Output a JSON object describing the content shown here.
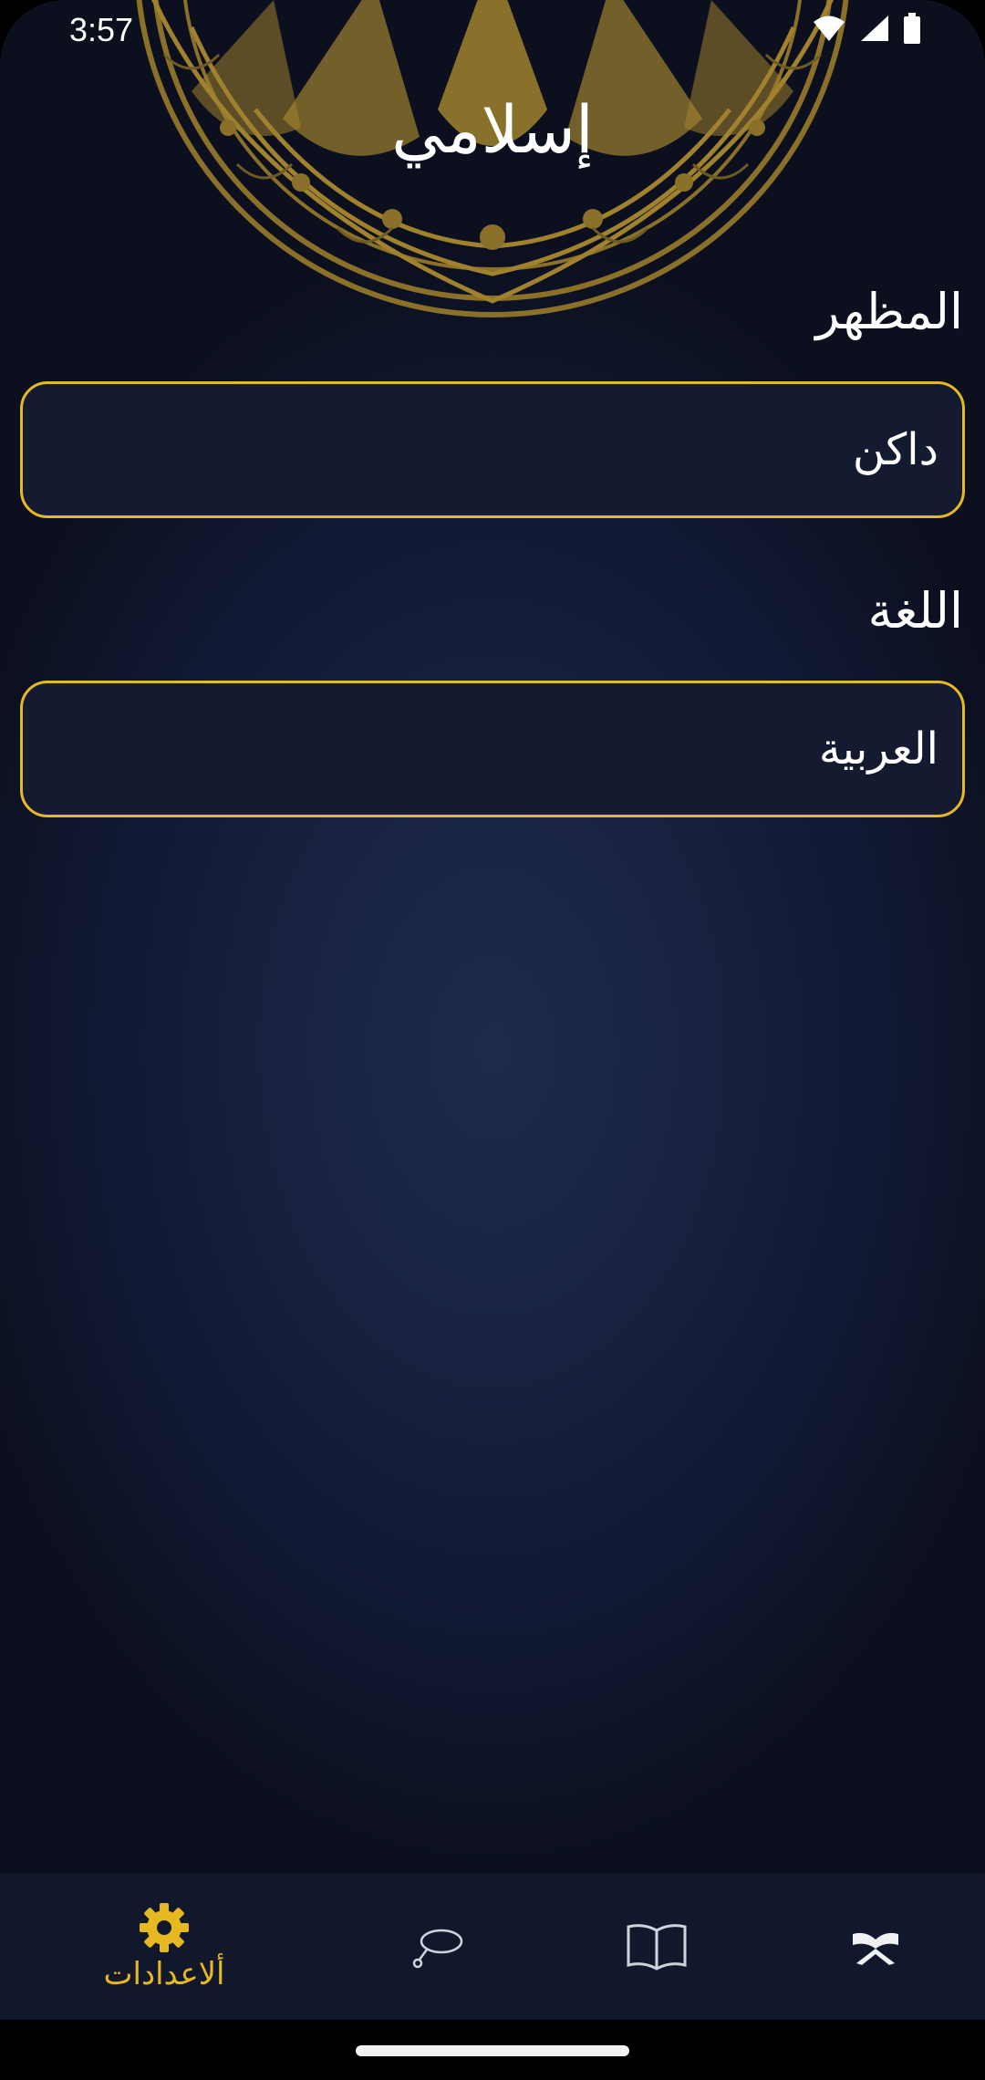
{
  "status_bar": {
    "time": "3:57",
    "icons": [
      "wifi-icon",
      "signal-icon",
      "battery-icon"
    ]
  },
  "app": {
    "title": "إسلامي"
  },
  "settings": {
    "theme": {
      "label": "المظهر",
      "value": "داكن"
    },
    "language": {
      "label": "اللغة",
      "value": "العربية"
    }
  },
  "bottom_nav": {
    "items": [
      {
        "name": "settings",
        "label": "ألاعدادات",
        "icon": "gear-icon",
        "active": true
      },
      {
        "name": "tasbeeh",
        "label": "",
        "icon": "prayer-beads-icon",
        "active": false
      },
      {
        "name": "hadith",
        "label": "",
        "icon": "open-book-icon",
        "active": false
      },
      {
        "name": "quran",
        "label": "",
        "icon": "quran-stand-icon",
        "active": false
      }
    ]
  },
  "colors": {
    "accent": "#e6b821",
    "background": "#18213f",
    "nav_background": "#12182c",
    "text": "#ffffff"
  }
}
